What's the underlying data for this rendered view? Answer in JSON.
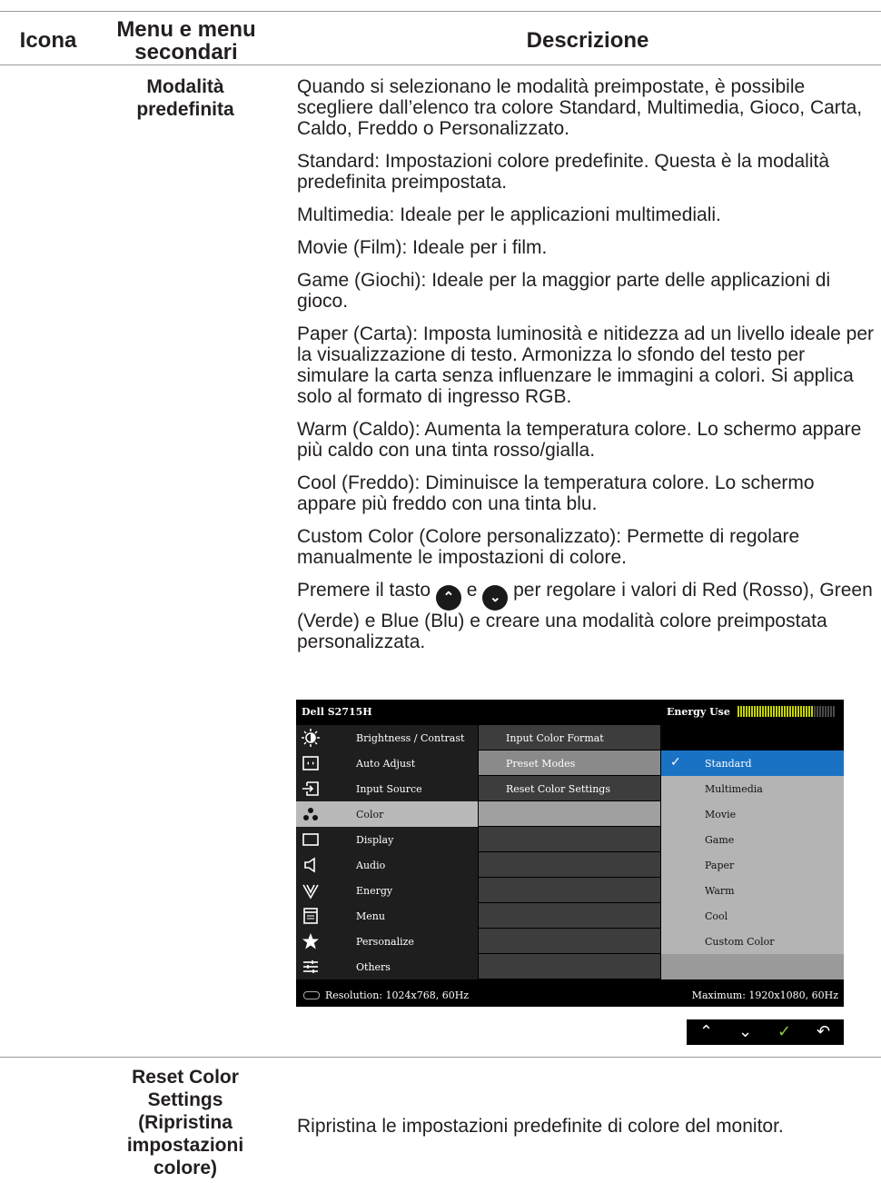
{
  "headers": {
    "icon": "Icona",
    "menu": "Menu e menu\nsecondari",
    "description": "Descrizione"
  },
  "row1": {
    "submenu": "Modalità\npredefinita",
    "paragraphs": [
      "Quando si selezionano le modalità preimpostate, è possibile scegliere dall’elenco tra colore Standard, Multimedia, Gioco, Carta, Caldo, Freddo o Personalizzato.",
      "Standard: Impostazioni colore predefinite. Questa è la modalità predefinita preimpostata.",
      "Multimedia: Ideale per le applicazioni multimediali.",
      "Movie (Film): Ideale per i film.",
      "Game (Giochi): Ideale per la maggior parte delle applicazioni di gioco.",
      "Paper (Carta): Imposta luminosità e nitidezza ad un livello ideale per la visualizzazione di testo. Armonizza lo sfondo del testo per simulare la carta senza influenzare le immagini a colori. Si applica solo al formato di ingresso RGB.",
      "Warm (Caldo): Aumenta la temperatura colore. Lo schermo appare più caldo con una tinta rosso/gialla.",
      "Cool (Freddo): Diminuisce la temperatura colore. Lo schermo appare più freddo con una tinta blu.",
      "Custom Color (Colore personalizzato): Permette di regolare manualmente le impostazioni di colore."
    ],
    "last_para": {
      "pre": "Premere il tasto",
      "mid": "e",
      "post": "per regolare i valori di Red (Rosso), Green (Verde) e Blue (Blu) e creare una modalità colore preimpostata personalizzata."
    }
  },
  "osd": {
    "model": "Dell S2715H",
    "energy_label": "Energy Use",
    "energy_level": 0.78,
    "menu": [
      {
        "label": "Brightness / Contrast",
        "icon": "brightness-icon"
      },
      {
        "label": "Auto Adjust",
        "icon": "auto-adjust-icon"
      },
      {
        "label": "Input Source",
        "icon": "input-source-icon"
      },
      {
        "label": "Color",
        "icon": "color-icon",
        "selected": true
      },
      {
        "label": "Display",
        "icon": "display-icon"
      },
      {
        "label": "Audio",
        "icon": "audio-icon"
      },
      {
        "label": "Energy",
        "icon": "energy-icon"
      },
      {
        "label": "Menu",
        "icon": "menu-icon"
      },
      {
        "label": "Personalize",
        "icon": "star-icon"
      },
      {
        "label": "Others",
        "icon": "others-icon"
      }
    ],
    "submenu": [
      "Input Color Format",
      "Preset Modes",
      "Reset Color Settings"
    ],
    "submenu_selected": 1,
    "presets": [
      "Standard",
      "Multimedia",
      "Movie",
      "Game",
      "Paper",
      "Warm",
      "Cool",
      "Custom Color"
    ],
    "preset_selected": 0,
    "resolution": "Resolution: 1024x768, 60Hz",
    "maximum": "Maximum: 1920x1080, 60Hz",
    "accent": "#1a72c4"
  },
  "buttons": [
    "up-icon",
    "down-icon",
    "check-icon",
    "back-icon"
  ],
  "row2": {
    "submenu": "Reset Color\nSettings\n(Ripristina\nimpostazioni\ncolore)",
    "description": "Ripristina le impostazioni predefinite di colore del monitor."
  }
}
